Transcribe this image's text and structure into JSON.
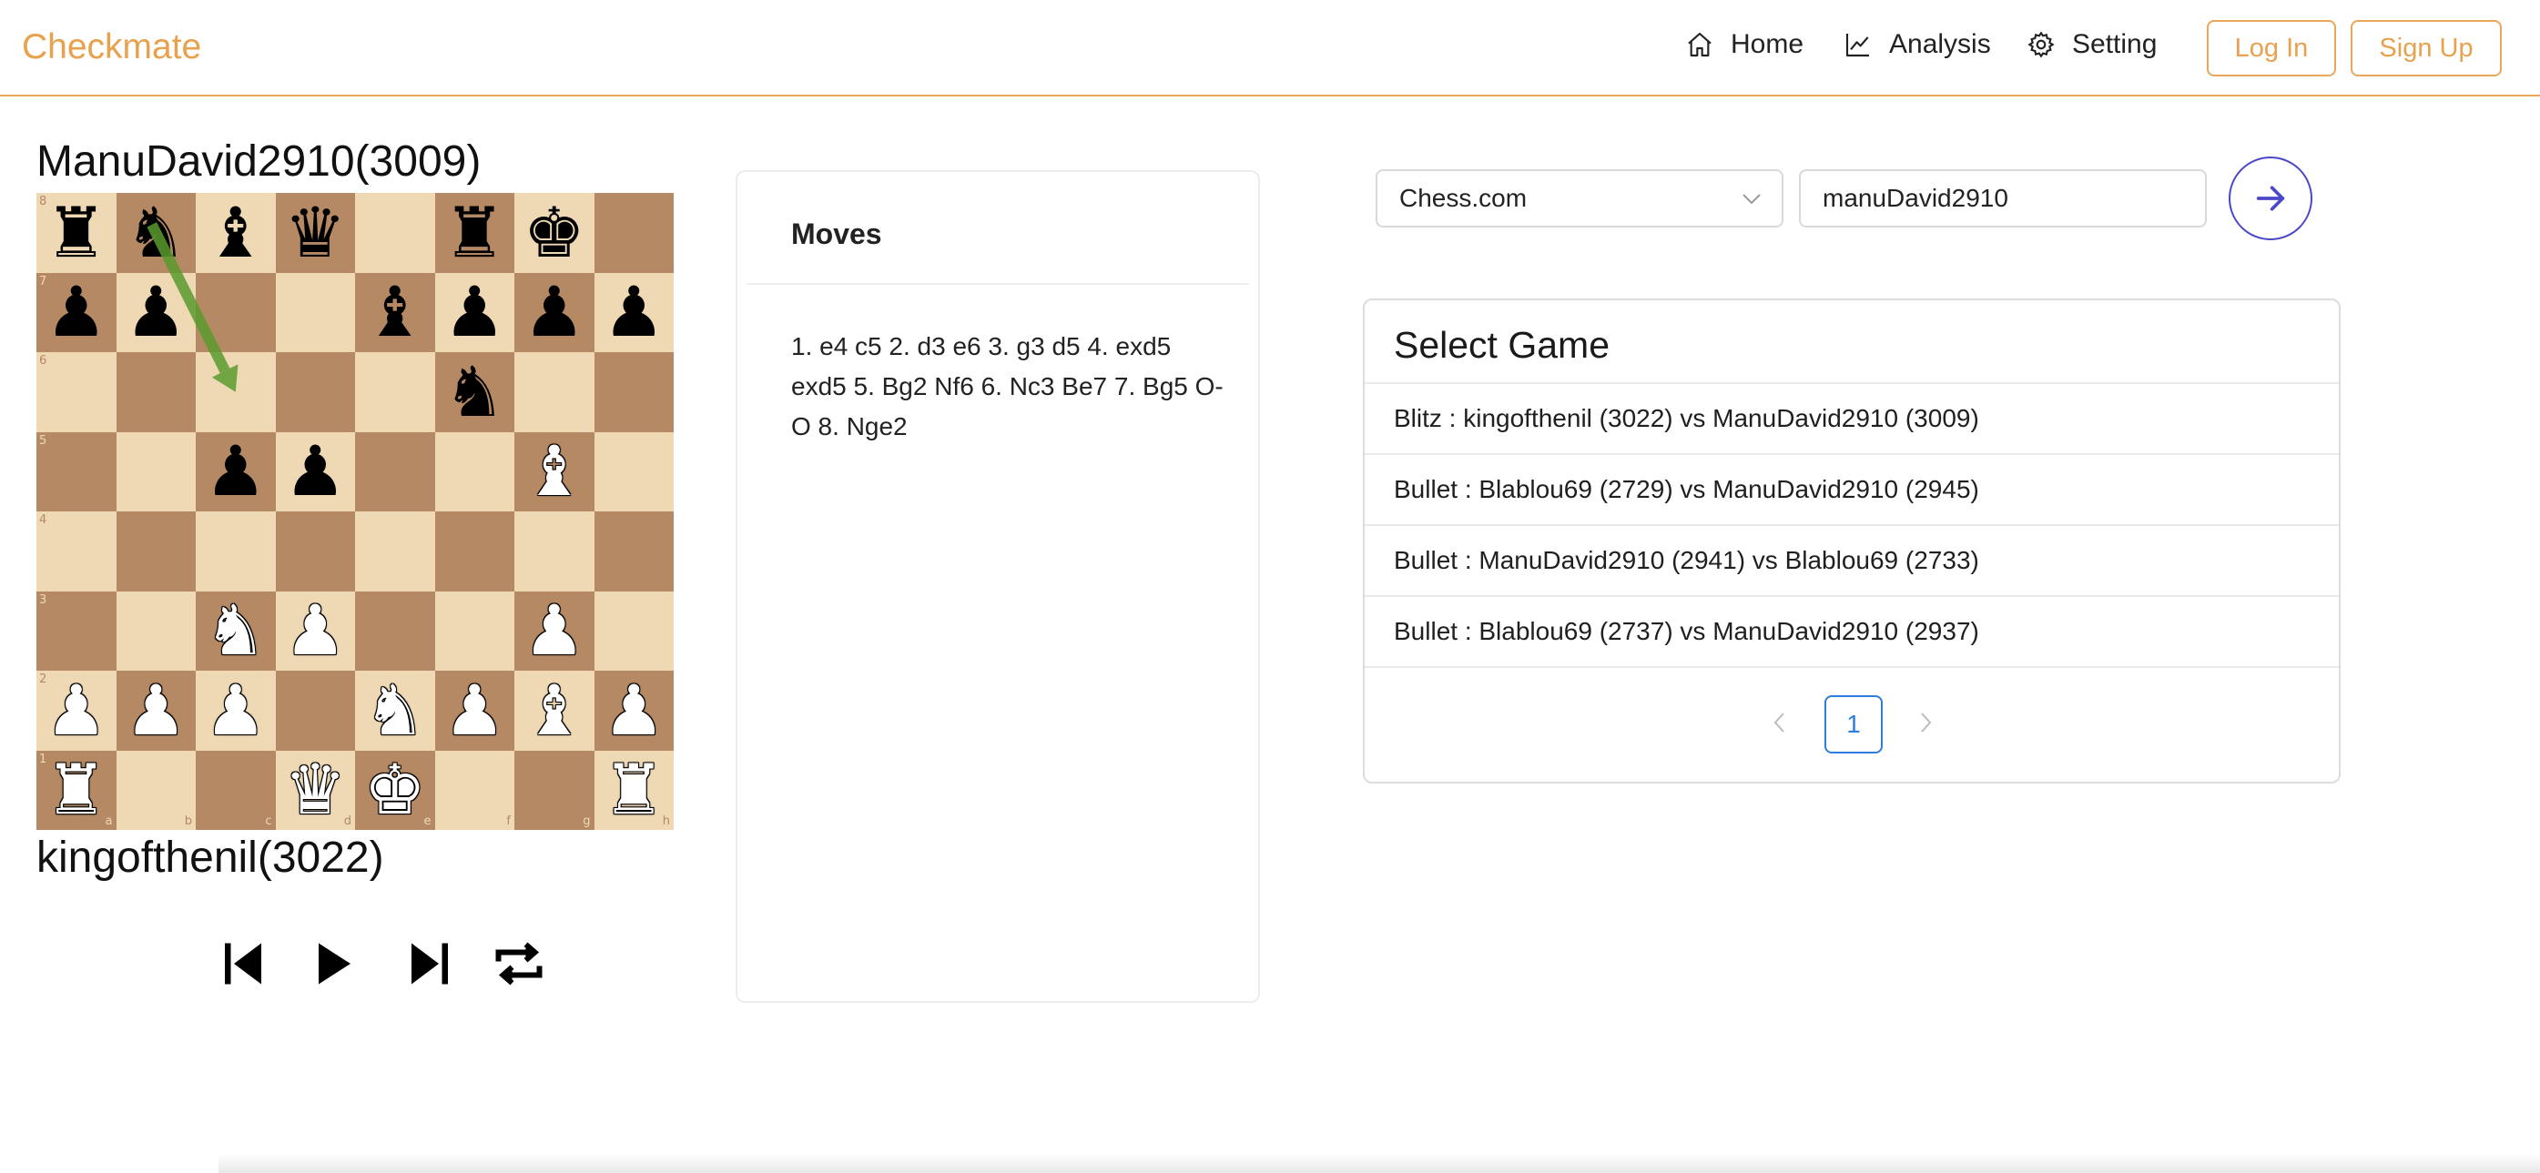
{
  "app": {
    "brand": "Checkmate"
  },
  "nav": {
    "links": [
      {
        "label": "Home",
        "icon": "home-icon"
      },
      {
        "label": "Analysis",
        "icon": "chart-line-icon"
      },
      {
        "label": "Setting",
        "icon": "gear-icon"
      }
    ],
    "login_label": "Log In",
    "signup_label": "Sign Up"
  },
  "players": {
    "top": "ManuDavid2910(3009)",
    "bottom": "kingofthenil(3022)"
  },
  "board": {
    "orientation": "white-bottom",
    "ranks": [
      [
        "br",
        "bn",
        "bb",
        "bq",
        "",
        "br",
        "bk",
        ""
      ],
      [
        "bp",
        "bp",
        "",
        "",
        "bb",
        "bp",
        "bp",
        "bp"
      ],
      [
        "",
        "",
        "",
        "",
        "",
        "bn",
        "",
        ""
      ],
      [
        "",
        "",
        "bp",
        "bp",
        "",
        "",
        "wb",
        ""
      ],
      [
        "",
        "",
        "",
        "",
        "",
        "",
        "",
        ""
      ],
      [
        "",
        "",
        "wn",
        "wp",
        "",
        "",
        "wp",
        ""
      ],
      [
        "wp",
        "wp",
        "wp",
        "",
        "wn",
        "wp",
        "wb",
        "wp"
      ],
      [
        "wr",
        "",
        "",
        "wq",
        "wk",
        "",
        "",
        "wr"
      ]
    ],
    "rank_labels": [
      "8",
      "7",
      "6",
      "5",
      "4",
      "3",
      "2",
      "1"
    ],
    "file_labels": [
      "a",
      "b",
      "c",
      "d",
      "e",
      "f",
      "g",
      "h"
    ],
    "arrow": {
      "from": "b8",
      "to": "c6",
      "color": "#5b9a2e"
    },
    "light_color": "#efd9b5",
    "dark_color": "#b58963"
  },
  "controls": [
    {
      "name": "skip-start-icon"
    },
    {
      "name": "play-icon"
    },
    {
      "name": "skip-end-icon"
    },
    {
      "name": "repeat-icon"
    }
  ],
  "moves": {
    "title": "Moves",
    "text": "1. e4 c5 2. d3 e6 3. g3 d5 4. exd5 exd5 5. Bg2 Nf6 6. Nc3 Be7 7. Bg5 O-O 8. Nge2"
  },
  "search": {
    "platform": "Chess.com",
    "username": "manuDavid2910"
  },
  "games": {
    "title": "Select Game",
    "items": [
      "Blitz : kingofthenil (3022) vs ManuDavid2910 (3009)",
      "Bullet : Blablou69 (2729) vs ManuDavid2910 (2945)",
      "Bullet : ManuDavid2910 (2941) vs Blablou69 (2733)",
      "Bullet : Blablou69 (2737) vs ManuDavid2910 (2937)"
    ],
    "current_page": "1"
  },
  "colors": {
    "accent": "#e8a14d",
    "primary": "#4b47c9",
    "page_active": "#2f7de1"
  }
}
